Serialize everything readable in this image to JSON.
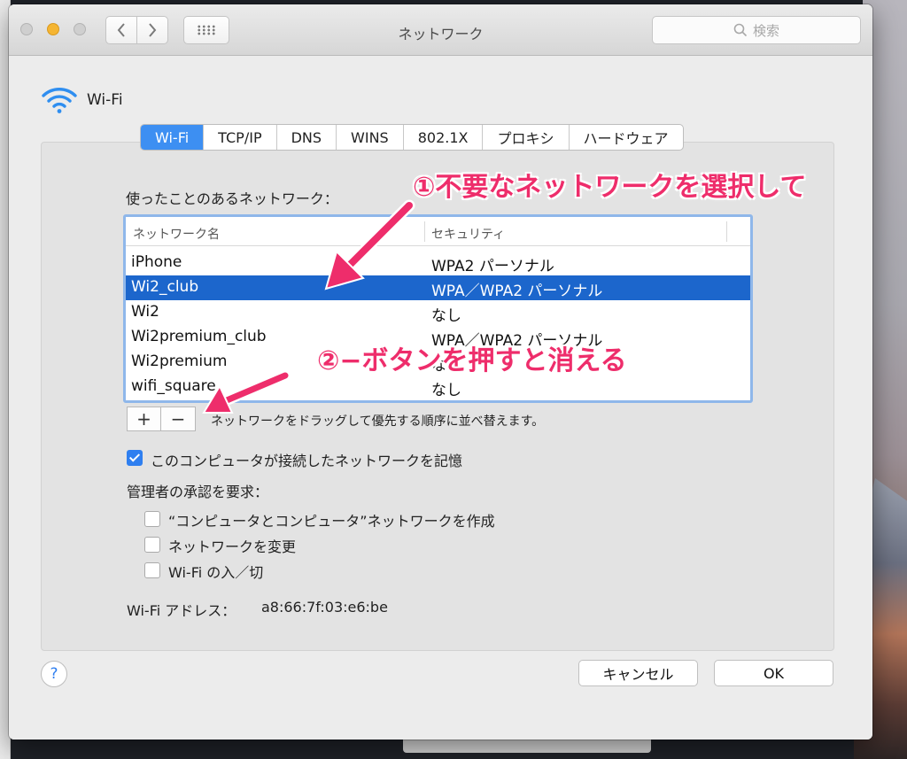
{
  "window": {
    "title": "ネットワーク",
    "search_placeholder": "検索"
  },
  "header": {
    "service_name": "Wi-Fi"
  },
  "tabs": [
    {
      "label": "Wi-Fi",
      "active": true
    },
    {
      "label": "TCP/IP"
    },
    {
      "label": "DNS"
    },
    {
      "label": "WINS"
    },
    {
      "label": "802.1X"
    },
    {
      "label": "プロキシ"
    },
    {
      "label": "ハードウェア"
    }
  ],
  "networks": {
    "label": "使ったことのあるネットワーク：",
    "columns": {
      "name": "ネットワーク名",
      "security": "セキュリティ"
    },
    "rows": [
      {
        "name": "iPhone",
        "security": "WPA2 パーソナル"
      },
      {
        "name": "Wi2_club",
        "security": "WPA／WPA2 パーソナル",
        "selected": true
      },
      {
        "name": "Wi2",
        "security": "なし"
      },
      {
        "name": "Wi2premium_club",
        "security": "WPA／WPA2 パーソナル"
      },
      {
        "name": "Wi2premium",
        "security": "なし"
      },
      {
        "name": "wifi_square",
        "security": "なし"
      }
    ],
    "add_label": "+",
    "remove_label": "−",
    "drag_hint": "ネットワークをドラッグして優先する順序に並べ替えます。"
  },
  "options": {
    "remember": {
      "label": "このコンピュータが接続したネットワークを記憶",
      "checked": true
    },
    "admin_required_label": "管理者の承認を要求：",
    "create_computer_network": {
      "label": "“コンピュータとコンピュータ”ネットワークを作成",
      "checked": false
    },
    "change_network": {
      "label": "ネットワークを変更",
      "checked": false
    },
    "wifi_toggle": {
      "label": "Wi-Fi の入／切",
      "checked": false
    }
  },
  "address": {
    "label": "Wi-Fi アドレス：",
    "value": "a8:66:7f:03:e6:be"
  },
  "footer": {
    "help_label": "?",
    "cancel_label": "キャンセル",
    "ok_label": "OK"
  },
  "annotations": {
    "step1": "①不要なネットワークを選択して",
    "step2": "②−ボタンを押すと消える",
    "color": "#ee2d6b"
  },
  "colors": {
    "accent": "#3d8ff2",
    "selection": "#1c66cc"
  },
  "icons": {
    "header": "wifi-icon",
    "search": "search-icon",
    "back": "chevron-left-icon",
    "forward": "chevron-right-icon",
    "show_all": "grid-icon"
  }
}
